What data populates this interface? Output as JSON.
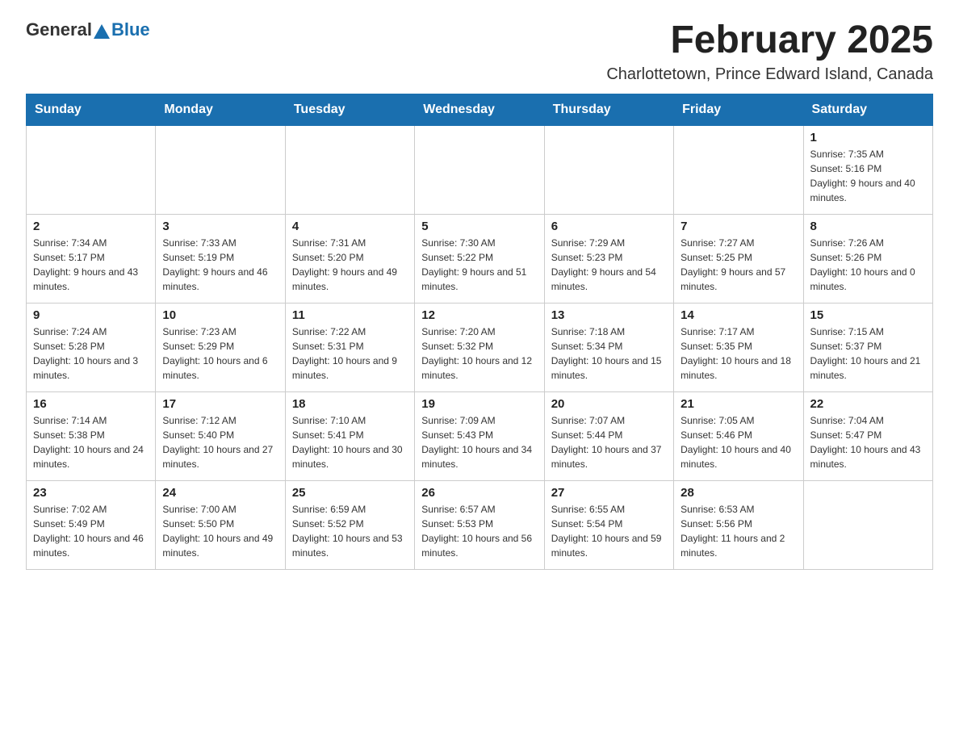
{
  "logo": {
    "general": "General",
    "blue": "Blue"
  },
  "title": "February 2025",
  "subtitle": "Charlottetown, Prince Edward Island, Canada",
  "days_of_week": [
    "Sunday",
    "Monday",
    "Tuesday",
    "Wednesday",
    "Thursday",
    "Friday",
    "Saturday"
  ],
  "weeks": [
    [
      {
        "day": "",
        "info": ""
      },
      {
        "day": "",
        "info": ""
      },
      {
        "day": "",
        "info": ""
      },
      {
        "day": "",
        "info": ""
      },
      {
        "day": "",
        "info": ""
      },
      {
        "day": "",
        "info": ""
      },
      {
        "day": "1",
        "info": "Sunrise: 7:35 AM\nSunset: 5:16 PM\nDaylight: 9 hours and 40 minutes."
      }
    ],
    [
      {
        "day": "2",
        "info": "Sunrise: 7:34 AM\nSunset: 5:17 PM\nDaylight: 9 hours and 43 minutes."
      },
      {
        "day": "3",
        "info": "Sunrise: 7:33 AM\nSunset: 5:19 PM\nDaylight: 9 hours and 46 minutes."
      },
      {
        "day": "4",
        "info": "Sunrise: 7:31 AM\nSunset: 5:20 PM\nDaylight: 9 hours and 49 minutes."
      },
      {
        "day": "5",
        "info": "Sunrise: 7:30 AM\nSunset: 5:22 PM\nDaylight: 9 hours and 51 minutes."
      },
      {
        "day": "6",
        "info": "Sunrise: 7:29 AM\nSunset: 5:23 PM\nDaylight: 9 hours and 54 minutes."
      },
      {
        "day": "7",
        "info": "Sunrise: 7:27 AM\nSunset: 5:25 PM\nDaylight: 9 hours and 57 minutes."
      },
      {
        "day": "8",
        "info": "Sunrise: 7:26 AM\nSunset: 5:26 PM\nDaylight: 10 hours and 0 minutes."
      }
    ],
    [
      {
        "day": "9",
        "info": "Sunrise: 7:24 AM\nSunset: 5:28 PM\nDaylight: 10 hours and 3 minutes."
      },
      {
        "day": "10",
        "info": "Sunrise: 7:23 AM\nSunset: 5:29 PM\nDaylight: 10 hours and 6 minutes."
      },
      {
        "day": "11",
        "info": "Sunrise: 7:22 AM\nSunset: 5:31 PM\nDaylight: 10 hours and 9 minutes."
      },
      {
        "day": "12",
        "info": "Sunrise: 7:20 AM\nSunset: 5:32 PM\nDaylight: 10 hours and 12 minutes."
      },
      {
        "day": "13",
        "info": "Sunrise: 7:18 AM\nSunset: 5:34 PM\nDaylight: 10 hours and 15 minutes."
      },
      {
        "day": "14",
        "info": "Sunrise: 7:17 AM\nSunset: 5:35 PM\nDaylight: 10 hours and 18 minutes."
      },
      {
        "day": "15",
        "info": "Sunrise: 7:15 AM\nSunset: 5:37 PM\nDaylight: 10 hours and 21 minutes."
      }
    ],
    [
      {
        "day": "16",
        "info": "Sunrise: 7:14 AM\nSunset: 5:38 PM\nDaylight: 10 hours and 24 minutes."
      },
      {
        "day": "17",
        "info": "Sunrise: 7:12 AM\nSunset: 5:40 PM\nDaylight: 10 hours and 27 minutes."
      },
      {
        "day": "18",
        "info": "Sunrise: 7:10 AM\nSunset: 5:41 PM\nDaylight: 10 hours and 30 minutes."
      },
      {
        "day": "19",
        "info": "Sunrise: 7:09 AM\nSunset: 5:43 PM\nDaylight: 10 hours and 34 minutes."
      },
      {
        "day": "20",
        "info": "Sunrise: 7:07 AM\nSunset: 5:44 PM\nDaylight: 10 hours and 37 minutes."
      },
      {
        "day": "21",
        "info": "Sunrise: 7:05 AM\nSunset: 5:46 PM\nDaylight: 10 hours and 40 minutes."
      },
      {
        "day": "22",
        "info": "Sunrise: 7:04 AM\nSunset: 5:47 PM\nDaylight: 10 hours and 43 minutes."
      }
    ],
    [
      {
        "day": "23",
        "info": "Sunrise: 7:02 AM\nSunset: 5:49 PM\nDaylight: 10 hours and 46 minutes."
      },
      {
        "day": "24",
        "info": "Sunrise: 7:00 AM\nSunset: 5:50 PM\nDaylight: 10 hours and 49 minutes."
      },
      {
        "day": "25",
        "info": "Sunrise: 6:59 AM\nSunset: 5:52 PM\nDaylight: 10 hours and 53 minutes."
      },
      {
        "day": "26",
        "info": "Sunrise: 6:57 AM\nSunset: 5:53 PM\nDaylight: 10 hours and 56 minutes."
      },
      {
        "day": "27",
        "info": "Sunrise: 6:55 AM\nSunset: 5:54 PM\nDaylight: 10 hours and 59 minutes."
      },
      {
        "day": "28",
        "info": "Sunrise: 6:53 AM\nSunset: 5:56 PM\nDaylight: 11 hours and 2 minutes."
      },
      {
        "day": "",
        "info": ""
      }
    ]
  ]
}
